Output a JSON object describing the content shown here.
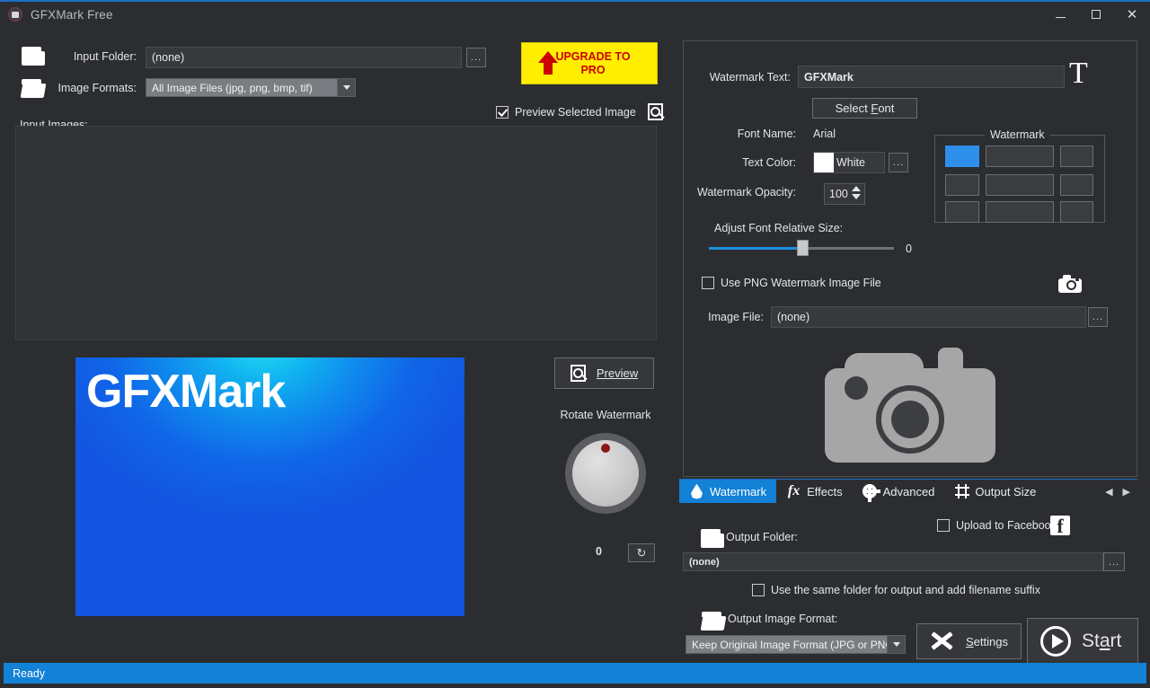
{
  "window": {
    "title": "GFXMark Free",
    "icon": "app-icon",
    "minimize": "—",
    "maximize": "□",
    "close": "✕"
  },
  "left": {
    "input_folder_label": "Input Folder:",
    "input_folder_value": "(none)",
    "input_folder_browse": "...",
    "image_formats_label": "Image Formats:",
    "image_formats_value": "All Image Files (jpg, png, bmp, tif)",
    "image_formats_options": [
      "All Image Files (jpg, png, bmp, tif)"
    ],
    "input_images_label": "Input Images:",
    "preview_checkbox_label": "Preview Selected Image",
    "preview_checkbox_checked": true,
    "preview_button_label": "Preview",
    "preview_image_watermark": "GFXMark",
    "rotate_label": "Rotate Watermark",
    "rotate_value": "0",
    "rotate_reset": "↻"
  },
  "upgrade": {
    "line1": "UPGRADE TO",
    "line2": "PRO"
  },
  "watermark": {
    "text_label": "Watermark Text:",
    "text_value": "GFXMark",
    "text_icon": "T",
    "select_font_label_pre": "Select ",
    "select_font_label_key": "F",
    "select_font_label_post": "ont",
    "font_name_label": "Font Name:",
    "font_name_value": "Arial",
    "text_color_label": "Text Color:",
    "text_color_value": "White",
    "text_color_hex": "#ffffff",
    "text_color_browse": "...",
    "opacity_label": "Watermark Opacity:",
    "opacity_value": "100",
    "font_size_label": "Adjust Font Relative Size:",
    "font_size_value": "0",
    "position_group_title": "Watermark",
    "position_selected_index": 0,
    "use_png_label": "Use PNG Watermark Image File",
    "use_png_checked": false,
    "image_file_label": "Image File:",
    "image_file_value": "(none)",
    "image_file_browse": "..."
  },
  "tabs": {
    "items": [
      {
        "label": "Watermark",
        "icon": "droplet-icon",
        "active": true
      },
      {
        "label": "Effects",
        "icon": "fx-icon",
        "active": false
      },
      {
        "label": "Advanced",
        "icon": "gear-icon",
        "active": false
      },
      {
        "label": "Output Size",
        "icon": "crop-icon",
        "active": false
      }
    ],
    "nav_prev": "◀",
    "nav_next": "▶"
  },
  "output": {
    "upload_facebook_label": "Upload to Facebook",
    "upload_facebook_checked": false,
    "facebook_icon_glyph": "f",
    "output_folder_label": "Output Folder:",
    "output_folder_value": "(none)",
    "output_folder_browse": "...",
    "same_folder_label": "Use the same folder for output and add filename suffix",
    "same_folder_checked": false,
    "format_label": "Output Image Format:",
    "format_value": "Keep Original Image Format (JPG or PNG)",
    "format_options": [
      "Keep Original Image Format (JPG or PNG)"
    ],
    "settings_label_pre": "",
    "settings_label_key": "S",
    "settings_label_post": "ettings",
    "start_label_pre": "St",
    "start_label_key": "a",
    "start_label_post": "rt"
  },
  "statusbar": {
    "text": "Ready"
  },
  "colors": {
    "accent": "#1281d6",
    "upgrade_bg": "#ffee00",
    "upgrade_fg": "#cc0000",
    "selected_cell": "#2f90ec",
    "window_bg": "#2b2d30"
  }
}
